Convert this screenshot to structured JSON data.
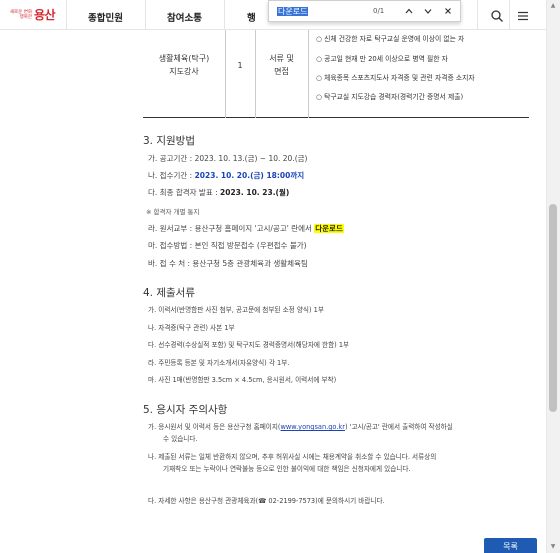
{
  "header": {
    "logo_small": "새로운 변화 행복한",
    "logo_main": "용산",
    "nav": [
      "종합민원",
      "참여소통",
      "행"
    ]
  },
  "findbar": {
    "query": "다운로드",
    "count": "0/1"
  },
  "table": {
    "job": "생활체육(탁구)\n지도강사",
    "count": "1",
    "method": "서류 및\n면접",
    "requirements": [
      "○ 신체 건강한 자로 탁구교실 운영에 이상이 없는 자",
      "○ 공고일 현재 만 20세 이상으로 병역 필한 자",
      "○ 체육종목 스포츠지도사 자격증 및 관련 자격증 소지자",
      "○ 탁구교실 지도강습 경력자(경력기간 증명서 제출)"
    ]
  },
  "sections": {
    "s3": {
      "title": "3. 지원방법",
      "period": "가. 공고기간 : 2023. 10. 13.(금) ~ 10. 20.(금)",
      "deadline_prefix": "나. 접수기간 : ",
      "deadline": "2023. 10. 20.(금) 18:00까지",
      "announce_prefix": "다. 최종 합격자 발표 : ",
      "announce": "2023. 10. 23.(월)",
      "note": "※ 합격자 개별 통지",
      "form_prefix": "라. 원서교부 : 용산구청 홈페이지 '고시/공고' 란에서 ",
      "form_link": "다운로드",
      "method": "마. 접수방법 : 본인 직접 방문접수 (우편접수 불가)",
      "place": "바. 접 수 처 : 용산구청 5층 관광체육과 생활체육팀"
    },
    "s4": {
      "title": "4. 제출서류",
      "items": [
        "가. 이력서(반명함판 사진 첨부, 공고문에 첨부된 소정 양식) 1부",
        "나. 자격증(탁구 관련) 사본 1부",
        "다. 선수경력(수상실적 포함) 및 탁구지도 경력증명서(해당자에 한함) 1부",
        "라. 주민등록 등본 및 자기소개서(자유양식) 각 1부.",
        "마. 사진 1매(반명함판 3.5cm × 4.5cm, 응시원서, 이력서에 부착)"
      ]
    },
    "s5": {
      "title": "5. 응시자 주의사항",
      "a_prefix": "가. 응시원서 및 이력서 등은 용산구청 홈페이지(",
      "a_link": "www.yongsan.go.kr",
      "a_suffix": ") '고시/공고' 란에서 출력하여 작성하실",
      "a_cont": "수 있습니다.",
      "b_line1": "나. 제출된 서류는 일체 반환하지 않으며, 추후 허위사실 시에는 채용계약을 취소할 수 있습니다. 서류상의",
      "b_line2": "기재착오 또는 누락이나 연락불능 등으로 인한 불이익에 대한 책임은 신청자에게 있습니다.",
      "c": "다. 자세한 사항은 용산구청 관광체육과(☎ 02-2199-7573)에 문의하시기 바랍니다."
    }
  },
  "list_button": "목록",
  "colors": {
    "accent_blue": "#1f5bb3",
    "highlight": "#ffff00",
    "logo_red": "#d6272f"
  }
}
